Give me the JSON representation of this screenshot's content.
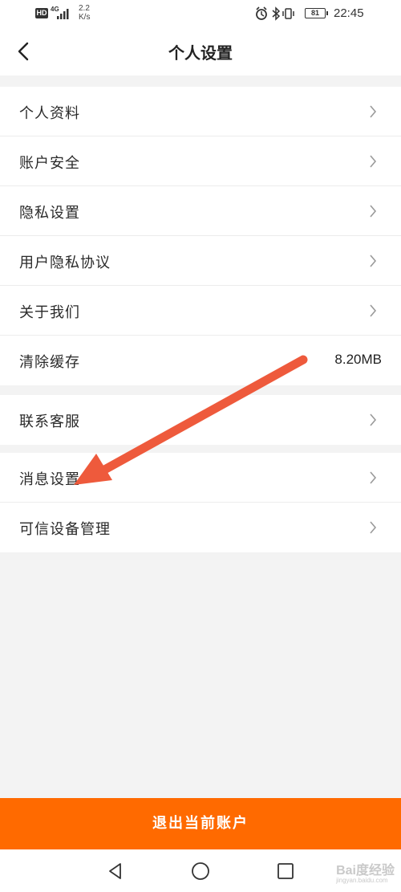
{
  "status_bar": {
    "hd": "HD",
    "network": "4G",
    "speed_value": "2.2",
    "speed_unit": "K/s",
    "battery": "81",
    "time": "22:45"
  },
  "header": {
    "title": "个人设置"
  },
  "groups": [
    {
      "items": [
        {
          "label": "个人资料",
          "has_chevron": true
        },
        {
          "label": "账户安全",
          "has_chevron": true
        },
        {
          "label": "隐私设置",
          "has_chevron": true
        },
        {
          "label": "用户隐私协议",
          "has_chevron": true
        },
        {
          "label": "关于我们",
          "has_chevron": true
        },
        {
          "label": "清除缓存",
          "value": "8.20MB"
        }
      ]
    },
    {
      "items": [
        {
          "label": "联系客服",
          "has_chevron": true
        }
      ]
    },
    {
      "items": [
        {
          "label": "消息设置",
          "has_chevron": true
        },
        {
          "label": "可信设备管理",
          "has_chevron": true
        }
      ]
    }
  ],
  "logout": {
    "label": "退出当前账户"
  },
  "watermark": {
    "text": "Bai度经验",
    "sub": "jingyan.baidu.com"
  },
  "colors": {
    "accent": "#ff6a00",
    "arrow": "#ee5a3c",
    "background": "#f3f3f3"
  },
  "icons": {
    "back": "chevron-left-icon",
    "row": "chevron-right-icon",
    "nav_back": "triangle-back-icon",
    "nav_home": "circle-home-icon",
    "nav_recent": "square-recent-icon"
  }
}
